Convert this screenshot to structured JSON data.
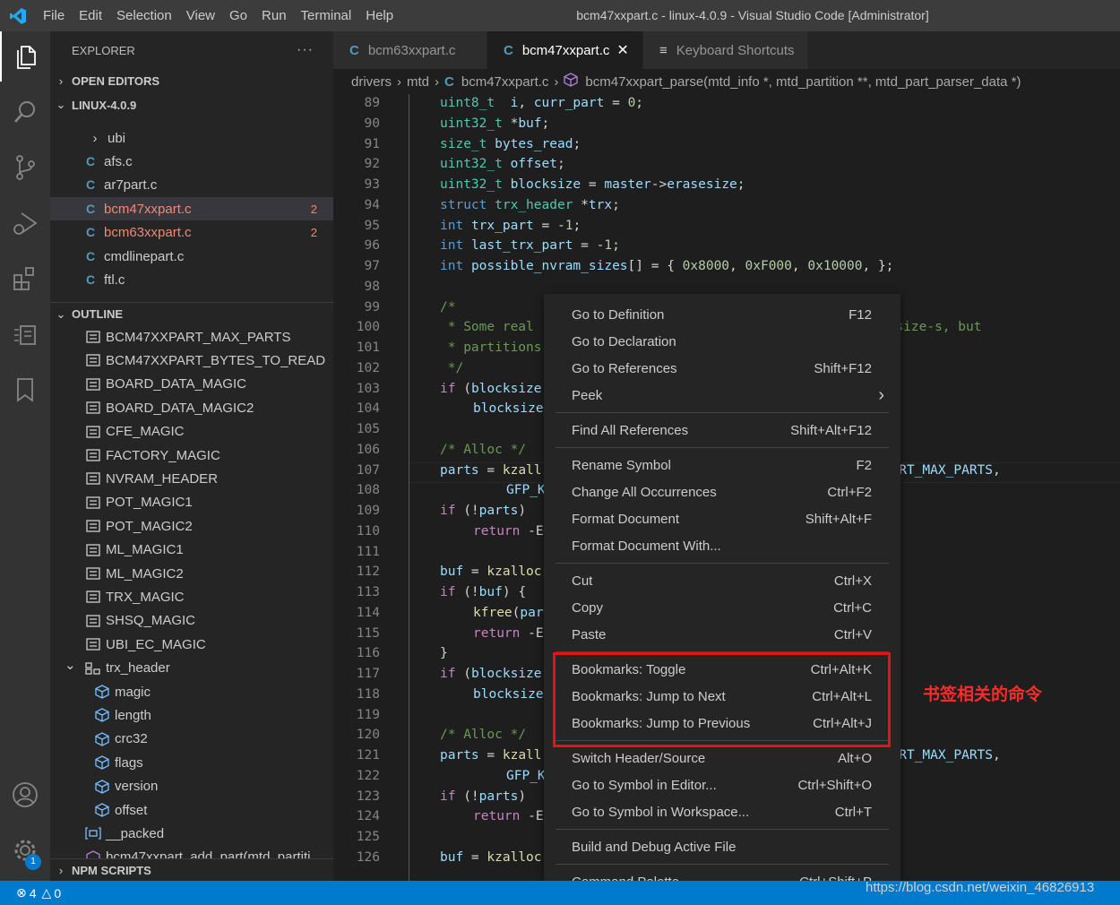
{
  "titlebar": {
    "menu": [
      "File",
      "Edit",
      "Selection",
      "View",
      "Go",
      "Run",
      "Terminal",
      "Help"
    ],
    "window_title": "bcm47xxpart.c - linux-4.0.9 - Visual Studio Code [Administrator]"
  },
  "activitybar": {
    "items": [
      "explorer-icon",
      "search-icon",
      "source-control-icon",
      "run-debug-icon",
      "extensions-icon",
      "remote-icon",
      "bookmarks-icon"
    ],
    "settings_badge": "1"
  },
  "sidebar": {
    "title": "EXPLORER",
    "more": "···",
    "open_editors": "OPEN EDITORS",
    "workspace": "LINUX-4.0.9",
    "files": [
      {
        "name": "ubi",
        "kind": "folder"
      },
      {
        "name": "afs.c",
        "kind": "c"
      },
      {
        "name": "ar7part.c",
        "kind": "c"
      },
      {
        "name": "bcm47xxpart.c",
        "kind": "c",
        "errors": "2"
      },
      {
        "name": "bcm63xxpart.c",
        "kind": "c",
        "errors": "2"
      },
      {
        "name": "cmdlinepart.c",
        "kind": "c"
      },
      {
        "name": "ftl.c",
        "kind": "c"
      }
    ],
    "outline_title": "OUTLINE",
    "outline": [
      {
        "name": "BCM47XXPART_MAX_PARTS",
        "kind": "const"
      },
      {
        "name": "BCM47XXPART_BYTES_TO_READ",
        "kind": "const"
      },
      {
        "name": "BOARD_DATA_MAGIC",
        "kind": "const"
      },
      {
        "name": "BOARD_DATA_MAGIC2",
        "kind": "const"
      },
      {
        "name": "CFE_MAGIC",
        "kind": "const"
      },
      {
        "name": "FACTORY_MAGIC",
        "kind": "const"
      },
      {
        "name": "NVRAM_HEADER",
        "kind": "const"
      },
      {
        "name": "POT_MAGIC1",
        "kind": "const"
      },
      {
        "name": "POT_MAGIC2",
        "kind": "const"
      },
      {
        "name": "ML_MAGIC1",
        "kind": "const"
      },
      {
        "name": "ML_MAGIC2",
        "kind": "const"
      },
      {
        "name": "TRX_MAGIC",
        "kind": "const"
      },
      {
        "name": "SHSQ_MAGIC",
        "kind": "const"
      },
      {
        "name": "UBI_EC_MAGIC",
        "kind": "const"
      },
      {
        "name": "trx_header",
        "kind": "struct"
      },
      {
        "name": "magic",
        "kind": "field"
      },
      {
        "name": "length",
        "kind": "field"
      },
      {
        "name": "crc32",
        "kind": "field"
      },
      {
        "name": "flags",
        "kind": "field"
      },
      {
        "name": "version",
        "kind": "field"
      },
      {
        "name": "offset",
        "kind": "field"
      },
      {
        "name": "__packed",
        "kind": "var"
      },
      {
        "name": "bcm47xxpart_add_part(mtd_partiti",
        "kind": "func"
      }
    ],
    "npm_scripts": "NPM SCRIPTS"
  },
  "tabs": [
    {
      "label": "bcm63xxpart.c",
      "icon": "C",
      "active": false
    },
    {
      "label": "bcm47xxpart.c",
      "icon": "C",
      "active": true,
      "close": "✕"
    },
    {
      "label": "Keyboard Shortcuts",
      "icon": "≡",
      "active": false
    }
  ],
  "breadcrumb": [
    "drivers",
    "mtd",
    "bcm47xxpart.c",
    "bcm47xxpart_parse(mtd_info *, mtd_partition **, mtd_part_parser_data *)"
  ],
  "editor": {
    "lines": [
      {
        "n": "89",
        "indent": 1,
        "tokens": [
          [
            "t",
            "uint8_t"
          ],
          [
            "",
            "  "
          ],
          [
            "v",
            "i"
          ],
          [
            "",
            ", "
          ],
          [
            "v",
            "curr_part"
          ],
          [
            "",
            " = "
          ],
          [
            "n",
            "0"
          ],
          [
            "",
            ";"
          ]
        ]
      },
      {
        "n": "90",
        "indent": 1,
        "tokens": [
          [
            "t",
            "uint32_t"
          ],
          [
            "",
            " *"
          ],
          [
            "v",
            "buf"
          ],
          [
            "",
            ";"
          ]
        ]
      },
      {
        "n": "91",
        "indent": 1,
        "tokens": [
          [
            "t",
            "size_t"
          ],
          [
            "",
            " "
          ],
          [
            "v",
            "bytes_read"
          ],
          [
            "",
            ";"
          ]
        ]
      },
      {
        "n": "92",
        "indent": 1,
        "tokens": [
          [
            "t",
            "uint32_t"
          ],
          [
            "",
            " "
          ],
          [
            "v",
            "offset"
          ],
          [
            "",
            ";"
          ]
        ]
      },
      {
        "n": "93",
        "indent": 1,
        "tokens": [
          [
            "t",
            "uint32_t"
          ],
          [
            "",
            " "
          ],
          [
            "v",
            "blocksize"
          ],
          [
            "",
            " = "
          ],
          [
            "v",
            "master"
          ],
          [
            "",
            "->"
          ],
          [
            "v",
            "erasesize"
          ],
          [
            "",
            ";"
          ]
        ]
      },
      {
        "n": "94",
        "indent": 1,
        "tokens": [
          [
            "k",
            "struct"
          ],
          [
            "",
            " "
          ],
          [
            "t",
            "trx_header"
          ],
          [
            "",
            " *"
          ],
          [
            "v",
            "trx"
          ],
          [
            "",
            ";"
          ]
        ]
      },
      {
        "n": "95",
        "indent": 1,
        "tokens": [
          [
            "k",
            "int"
          ],
          [
            "",
            " "
          ],
          [
            "v",
            "trx_part"
          ],
          [
            "",
            " = -"
          ],
          [
            "n",
            "1"
          ],
          [
            "",
            ";"
          ]
        ]
      },
      {
        "n": "96",
        "indent": 1,
        "tokens": [
          [
            "k",
            "int"
          ],
          [
            "",
            " "
          ],
          [
            "v",
            "last_trx_part"
          ],
          [
            "",
            " = -"
          ],
          [
            "n",
            "1"
          ],
          [
            "",
            ";"
          ]
        ]
      },
      {
        "n": "97",
        "indent": 1,
        "tokens": [
          [
            "k",
            "int"
          ],
          [
            "",
            " "
          ],
          [
            "v",
            "possible_nvram_sizes"
          ],
          [
            "",
            "[] = { "
          ],
          [
            "n",
            "0x8000"
          ],
          [
            "",
            ", "
          ],
          [
            "n",
            "0xF000"
          ],
          [
            "",
            ", "
          ],
          [
            "n",
            "0x10000"
          ],
          [
            "",
            ", };"
          ]
        ]
      },
      {
        "n": "98",
        "indent": 1,
        "tokens": []
      },
      {
        "n": "99",
        "indent": 1,
        "tokens": [
          [
            "cm",
            "/*"
          ]
        ]
      },
      {
        "n": "100",
        "indent": 1,
        "tokens": [
          [
            "cm",
            " * Some real"
          ],
          [
            "ctx",
            ""
          ],
          [
            "cm",
            "erasesize-s, but"
          ]
        ]
      },
      {
        "n": "101",
        "indent": 1,
        "tokens": [
          [
            "cm",
            " * partitions"
          ]
        ]
      },
      {
        "n": "102",
        "indent": 1,
        "tokens": [
          [
            "cm",
            " */"
          ]
        ]
      },
      {
        "n": "103",
        "indent": 1,
        "tokens": [
          [
            "ck",
            "if"
          ],
          [
            "",
            " ("
          ],
          [
            "v",
            "blocksize"
          ]
        ]
      },
      {
        "n": "104",
        "indent": 2,
        "tokens": [
          [
            "v",
            "blocksize"
          ]
        ]
      },
      {
        "n": "105",
        "indent": 1,
        "tokens": []
      },
      {
        "n": "106",
        "indent": 1,
        "tokens": [
          [
            "cm",
            "/* Alloc */"
          ]
        ]
      },
      {
        "n": "107",
        "indent": 1,
        "tokens": [
          [
            "v",
            "parts"
          ],
          [
            "",
            " = "
          ],
          [
            "fn",
            "kzall"
          ],
          [
            "ctx",
            ""
          ],
          [
            "v",
            "ART_MAX_PARTS"
          ],
          [
            "",
            ","
          ]
        ]
      },
      {
        "n": "108",
        "indent": 3,
        "tokens": [
          [
            "v",
            "GFP_K"
          ]
        ]
      },
      {
        "n": "109",
        "indent": 1,
        "tokens": [
          [
            "ck",
            "if"
          ],
          [
            "",
            " (!"
          ],
          [
            "v",
            "parts"
          ],
          [
            "",
            ")"
          ]
        ]
      },
      {
        "n": "110",
        "indent": 2,
        "tokens": [
          [
            "ck",
            "return"
          ],
          [
            "",
            " -E"
          ]
        ]
      },
      {
        "n": "111",
        "indent": 1,
        "tokens": []
      },
      {
        "n": "112",
        "indent": 1,
        "tokens": [
          [
            "v",
            "buf"
          ],
          [
            "",
            " = "
          ],
          [
            "fn",
            "kzalloc"
          ]
        ]
      },
      {
        "n": "113",
        "indent": 1,
        "tokens": [
          [
            "ck",
            "if"
          ],
          [
            "",
            " (!"
          ],
          [
            "v",
            "buf"
          ],
          [
            "",
            ") {"
          ]
        ]
      },
      {
        "n": "114",
        "indent": 2,
        "tokens": [
          [
            "fn",
            "kfree"
          ],
          [
            "",
            "("
          ],
          [
            "v",
            "par"
          ]
        ]
      },
      {
        "n": "115",
        "indent": 2,
        "tokens": [
          [
            "ck",
            "return"
          ],
          [
            "",
            " -E"
          ]
        ]
      },
      {
        "n": "116",
        "indent": 1,
        "tokens": [
          [
            "",
            "}"
          ]
        ]
      },
      {
        "n": "117",
        "indent": 1,
        "tokens": [
          [
            "ck",
            "if"
          ],
          [
            "",
            " ("
          ],
          [
            "v",
            "blocksize"
          ]
        ]
      },
      {
        "n": "118",
        "indent": 2,
        "tokens": [
          [
            "v",
            "blocksize"
          ]
        ]
      },
      {
        "n": "119",
        "indent": 1,
        "tokens": []
      },
      {
        "n": "120",
        "indent": 1,
        "tokens": [
          [
            "cm",
            "/* Alloc */"
          ]
        ]
      },
      {
        "n": "121",
        "indent": 1,
        "tokens": [
          [
            "v",
            "parts"
          ],
          [
            "",
            " = "
          ],
          [
            "fn",
            "kzall"
          ],
          [
            "ctx",
            ""
          ],
          [
            "v",
            "ART_MAX_PARTS"
          ],
          [
            "",
            ","
          ]
        ]
      },
      {
        "n": "122",
        "indent": 3,
        "tokens": [
          [
            "v",
            "GFP_K"
          ]
        ]
      },
      {
        "n": "123",
        "indent": 1,
        "tokens": [
          [
            "ck",
            "if"
          ],
          [
            "",
            " (!"
          ],
          [
            "v",
            "parts"
          ],
          [
            "",
            ")"
          ]
        ]
      },
      {
        "n": "124",
        "indent": 2,
        "tokens": [
          [
            "ck",
            "return"
          ],
          [
            "",
            " -E"
          ]
        ]
      },
      {
        "n": "125",
        "indent": 1,
        "tokens": []
      },
      {
        "n": "126",
        "indent": 1,
        "tokens": [
          [
            "v",
            "buf"
          ],
          [
            "",
            " = "
          ],
          [
            "fn",
            "kzalloc"
          ]
        ]
      }
    ]
  },
  "context_menu": {
    "groups": [
      [
        {
          "label": "Go to Definition",
          "key": "F12"
        },
        {
          "label": "Go to Declaration",
          "key": ""
        },
        {
          "label": "Go to References",
          "key": "Shift+F12"
        },
        {
          "label": "Peek",
          "key": "›"
        }
      ],
      [
        {
          "label": "Find All References",
          "key": "Shift+Alt+F12"
        }
      ],
      [
        {
          "label": "Rename Symbol",
          "key": "F2"
        },
        {
          "label": "Change All Occurrences",
          "key": "Ctrl+F2"
        },
        {
          "label": "Format Document",
          "key": "Shift+Alt+F"
        },
        {
          "label": "Format Document With...",
          "key": ""
        }
      ],
      [
        {
          "label": "Cut",
          "key": "Ctrl+X"
        },
        {
          "label": "Copy",
          "key": "Ctrl+C"
        },
        {
          "label": "Paste",
          "key": "Ctrl+V"
        }
      ],
      [
        {
          "label": "Bookmarks: Toggle",
          "key": "Ctrl+Alt+K"
        },
        {
          "label": "Bookmarks: Jump to Next",
          "key": "Ctrl+Alt+L"
        },
        {
          "label": "Bookmarks: Jump to Previous",
          "key": "Ctrl+Alt+J"
        }
      ],
      [
        {
          "label": "Switch Header/Source",
          "key": "Alt+O"
        },
        {
          "label": "Go to Symbol in Editor...",
          "key": "Ctrl+Shift+O"
        },
        {
          "label": "Go to Symbol in Workspace...",
          "key": "Ctrl+T"
        }
      ],
      [
        {
          "label": "Build and Debug Active File",
          "key": ""
        }
      ],
      [
        {
          "label": "Command Palette...",
          "key": "Ctrl+Shift+P"
        }
      ]
    ]
  },
  "annotation": "书签相关的命令",
  "watermark": "https://blog.csdn.net/weixin_46826913",
  "statusbar": {
    "errors": "4",
    "warnings": "0"
  },
  "colors": {
    "accent": "#007acc",
    "annotation_red": "#e51414",
    "error_red": "#f48771"
  }
}
